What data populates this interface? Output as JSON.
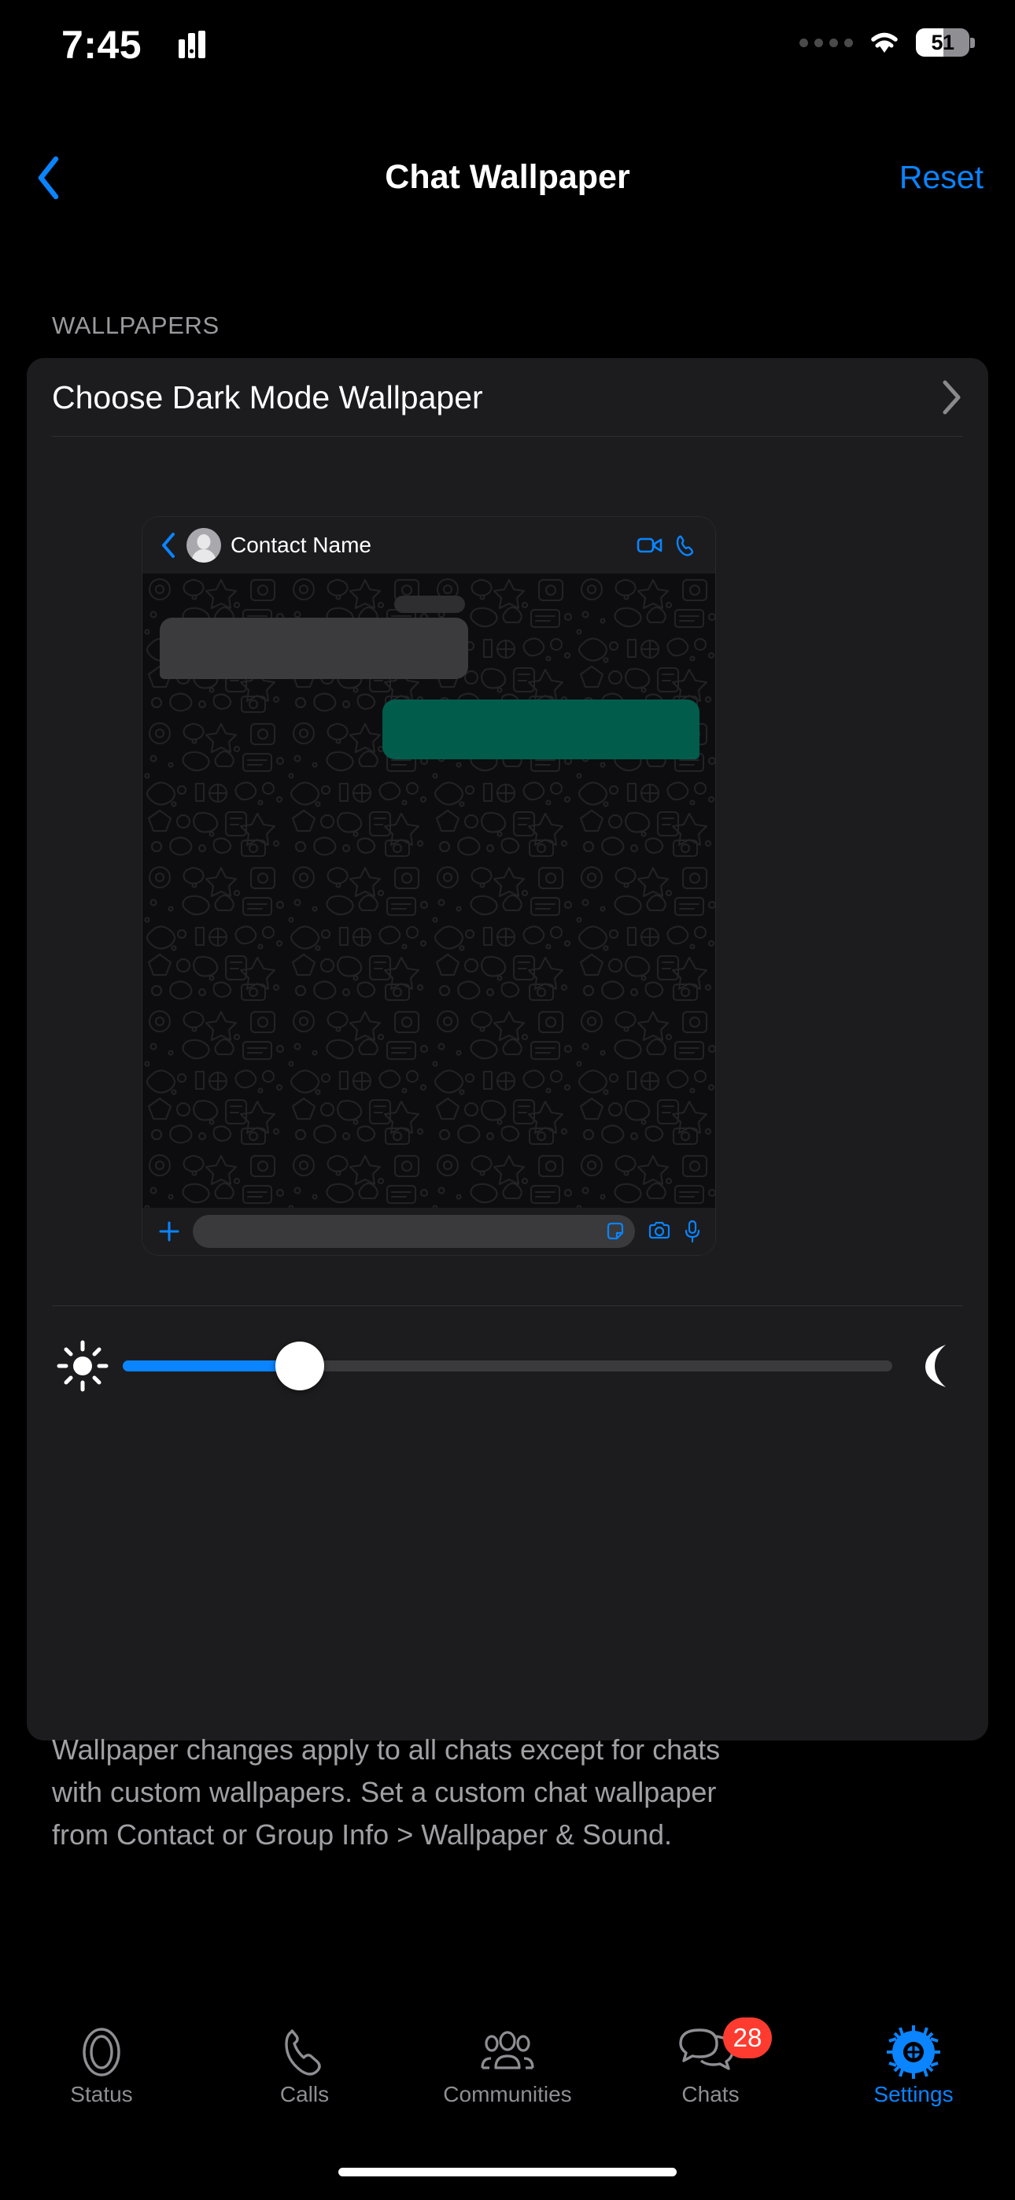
{
  "status_bar": {
    "time": "7:45",
    "app_icon": "chart-bars-icon",
    "signal_icon": "signal-dots-icon",
    "wifi_icon": "wifi-icon",
    "battery_percent": "51",
    "battery_level": 51
  },
  "nav": {
    "back_icon": "chevron-left-icon",
    "title": "Chat Wallpaper",
    "reset_label": "Reset",
    "accent_color": "#0a84ff"
  },
  "section": {
    "header": "WALLPAPERS",
    "row_label": "Choose Dark Mode Wallpaper",
    "row_chevron": "chevron-right-icon"
  },
  "preview": {
    "back_icon": "chevron-left-icon",
    "avatar": "contact-avatar",
    "contact_name": "Contact Name",
    "video_icon": "video-camera-icon",
    "call_icon": "phone-icon",
    "incoming_bubble_color": "#3b3b3d",
    "outgoing_bubble_color": "#015c4b",
    "wallpaper_bg": "#0d0d0f",
    "doodle_color": "#1f1f21",
    "input": {
      "plus_icon": "plus-icon",
      "field_placeholder": "",
      "field_value": "",
      "sticker_icon": "sticker-icon",
      "camera_icon": "camera-icon",
      "mic_icon": "microphone-icon"
    }
  },
  "brightness_slider": {
    "left_icon": "sun-icon",
    "right_icon": "moon-icon",
    "value_percent": 23,
    "fill_color": "#0a84ff",
    "track_color": "#3a3a3c",
    "thumb_color": "#ffffff"
  },
  "footer": {
    "lines": [
      "Wallpaper changes apply to all chats except for chats",
      "with custom wallpapers. Set a custom chat wallpaper",
      "from Contact or Group Info > Wallpaper & Sound."
    ]
  },
  "tabbar": {
    "items": [
      {
        "label": "Status",
        "icon": "status-rings-icon",
        "active": false,
        "badge": ""
      },
      {
        "label": "Calls",
        "icon": "phone-icon",
        "active": false,
        "badge": ""
      },
      {
        "label": "Communities",
        "icon": "communities-people-icon",
        "active": false,
        "badge": ""
      },
      {
        "label": "Chats",
        "icon": "chat-bubbles-icon",
        "active": false,
        "badge": "28"
      },
      {
        "label": "Settings",
        "icon": "gear-icon",
        "active": true,
        "badge": ""
      }
    ],
    "badge_color": "#ff3b30",
    "active_color": "#0a84ff",
    "inactive_color": "#8e8e93"
  }
}
